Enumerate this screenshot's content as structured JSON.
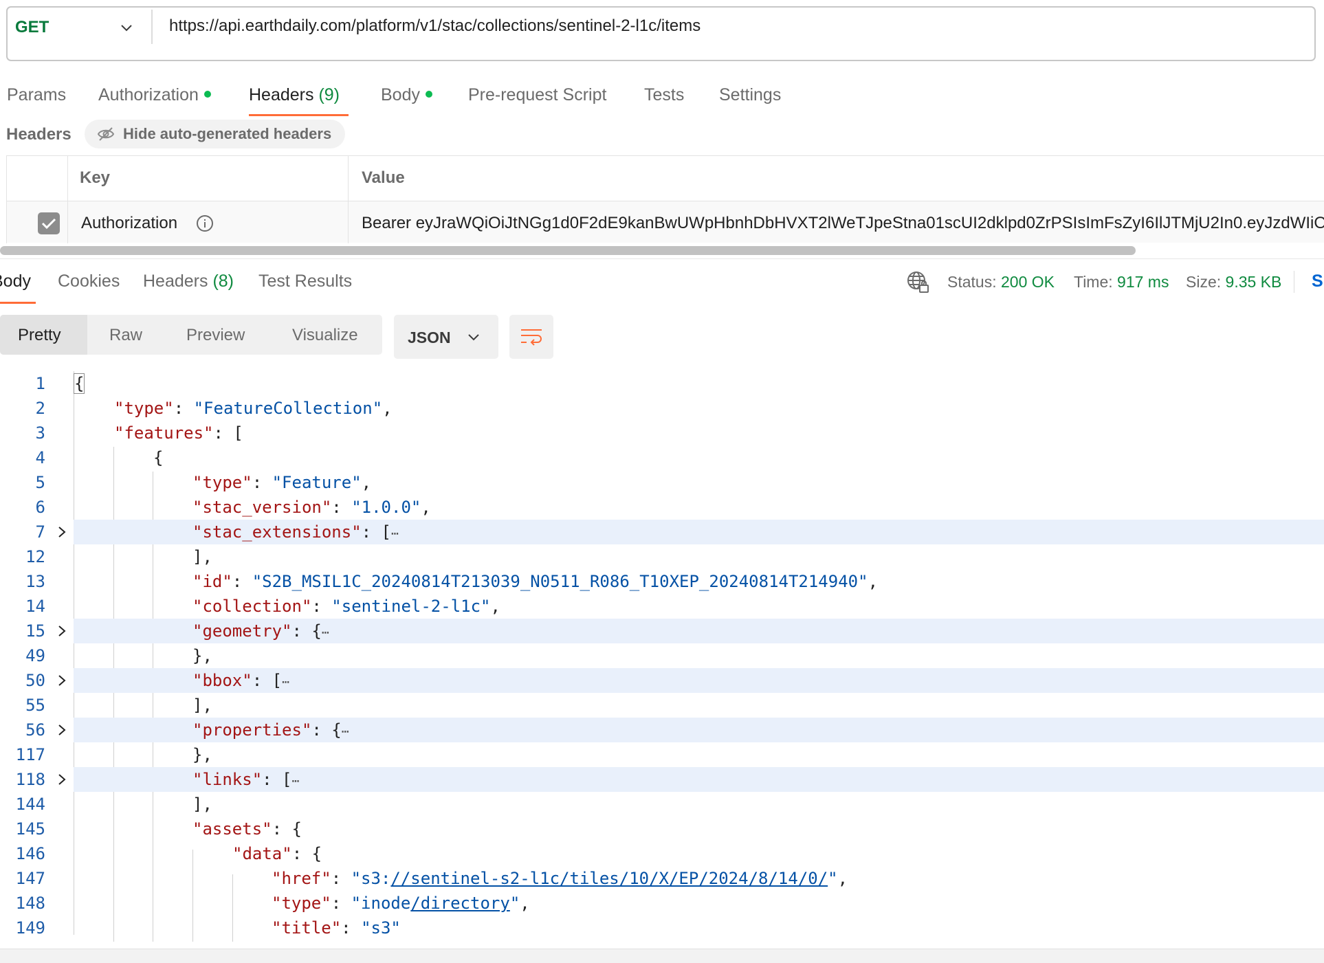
{
  "request": {
    "method": "GET",
    "url": "https://api.earthdaily.com/platform/v1/stac/collections/sentinel-2-l1c/items",
    "tabs": [
      {
        "label": "Params"
      },
      {
        "label": "Authorization"
      },
      {
        "label": "Headers",
        "count": "(9)"
      },
      {
        "label": "Body"
      },
      {
        "label": "Pre-request Script"
      },
      {
        "label": "Tests"
      },
      {
        "label": "Settings"
      }
    ],
    "headers_section_label": "Headers",
    "hide_auto_headers_label": "Hide auto-generated headers",
    "table": {
      "col_key": "Key",
      "col_value": "Value",
      "rows": [
        {
          "key": "Authorization",
          "value": "Bearer eyJraWQiOiJtNGg1d0F2dE9kanBwUWpHbnhDbHVXT2lWeTJpeStna01scUI2dklpd0ZrPSIsImFsZyI6IlJTMjU2In0.eyJzdWIiOi",
          "checked": true
        }
      ]
    }
  },
  "response": {
    "tabs": [
      {
        "label": "Body"
      },
      {
        "label": "Cookies"
      },
      {
        "label": "Headers",
        "count": "(8)"
      },
      {
        "label": "Test Results"
      }
    ],
    "status_label": "Status:",
    "status_value": "200 OK",
    "time_label": "Time:",
    "time_value": "917 ms",
    "size_label": "Size:",
    "size_value": "9.35 KB",
    "save_truncated": "S",
    "view_modes": [
      "Pretty",
      "Raw",
      "Preview",
      "Visualize"
    ],
    "format": "JSON",
    "lines": [
      {
        "n": "1"
      },
      {
        "n": "2"
      },
      {
        "n": "3"
      },
      {
        "n": "4"
      },
      {
        "n": "5"
      },
      {
        "n": "6"
      },
      {
        "n": "7"
      },
      {
        "n": "12"
      },
      {
        "n": "13"
      },
      {
        "n": "14"
      },
      {
        "n": "15"
      },
      {
        "n": "49"
      },
      {
        "n": "50"
      },
      {
        "n": "55"
      },
      {
        "n": "56"
      },
      {
        "n": "117"
      },
      {
        "n": "118"
      },
      {
        "n": "144"
      },
      {
        "n": "145"
      },
      {
        "n": "146"
      },
      {
        "n": "147"
      },
      {
        "n": "148"
      },
      {
        "n": "149"
      }
    ],
    "json": {
      "k_type": "\"type\"",
      "v_feature_collection": "\"FeatureCollection\"",
      "k_features": "\"features\"",
      "v_feature": "\"Feature\"",
      "k_stac_version": "\"stac_version\"",
      "v_stac_version": "\"1.0.0\"",
      "k_stac_extensions": "\"stac_extensions\"",
      "k_id": "\"id\"",
      "v_id": "\"S2B_MSIL1C_20240814T213039_N0511_R086_T10XEP_20240814T214940\"",
      "k_collection": "\"collection\"",
      "v_collection": "\"sentinel-2-l1c\"",
      "k_geometry": "\"geometry\"",
      "k_bbox": "\"bbox\"",
      "k_properties": "\"properties\"",
      "k_links": "\"links\"",
      "k_assets": "\"assets\"",
      "k_data": "\"data\"",
      "k_href": "\"href\"",
      "v_href_prefix": "\"s3:",
      "v_href_link": "//sentinel-s2-l1c/tiles/10/X/EP/2024/8/14/0/",
      "v_href_suffix": "\"",
      "v_inode_prefix": "\"inode",
      "v_inode_link": "/directory",
      "v_inode_suffix": "\"",
      "k_title": "\"title\"",
      "v_title": "\"s3\""
    }
  }
}
